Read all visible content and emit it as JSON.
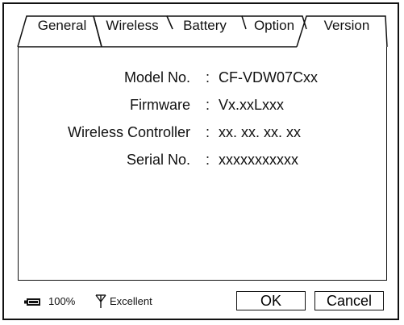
{
  "tabs": [
    {
      "label": "General"
    },
    {
      "label": "Wireless"
    },
    {
      "label": "Battery"
    },
    {
      "label": "Option"
    },
    {
      "label": "Version",
      "active": true
    }
  ],
  "info": {
    "rows": [
      {
        "label": "Model No.",
        "separator": ":",
        "value": "CF-VDW07Cxx"
      },
      {
        "label": "Firmware",
        "separator": ":",
        "value": "Vx.xxLxxx"
      },
      {
        "label": "Wireless Controller",
        "separator": ":",
        "value": "xx. xx. xx. xx"
      },
      {
        "label": "Serial No.",
        "separator": ":",
        "value": "xxxxxxxxxxx"
      }
    ]
  },
  "status": {
    "battery_icon": "battery-icon",
    "battery_level": "100%",
    "signal_icon": "antenna-icon",
    "signal_text": "Excellent"
  },
  "buttons": {
    "ok": "OK",
    "cancel": "Cancel"
  }
}
